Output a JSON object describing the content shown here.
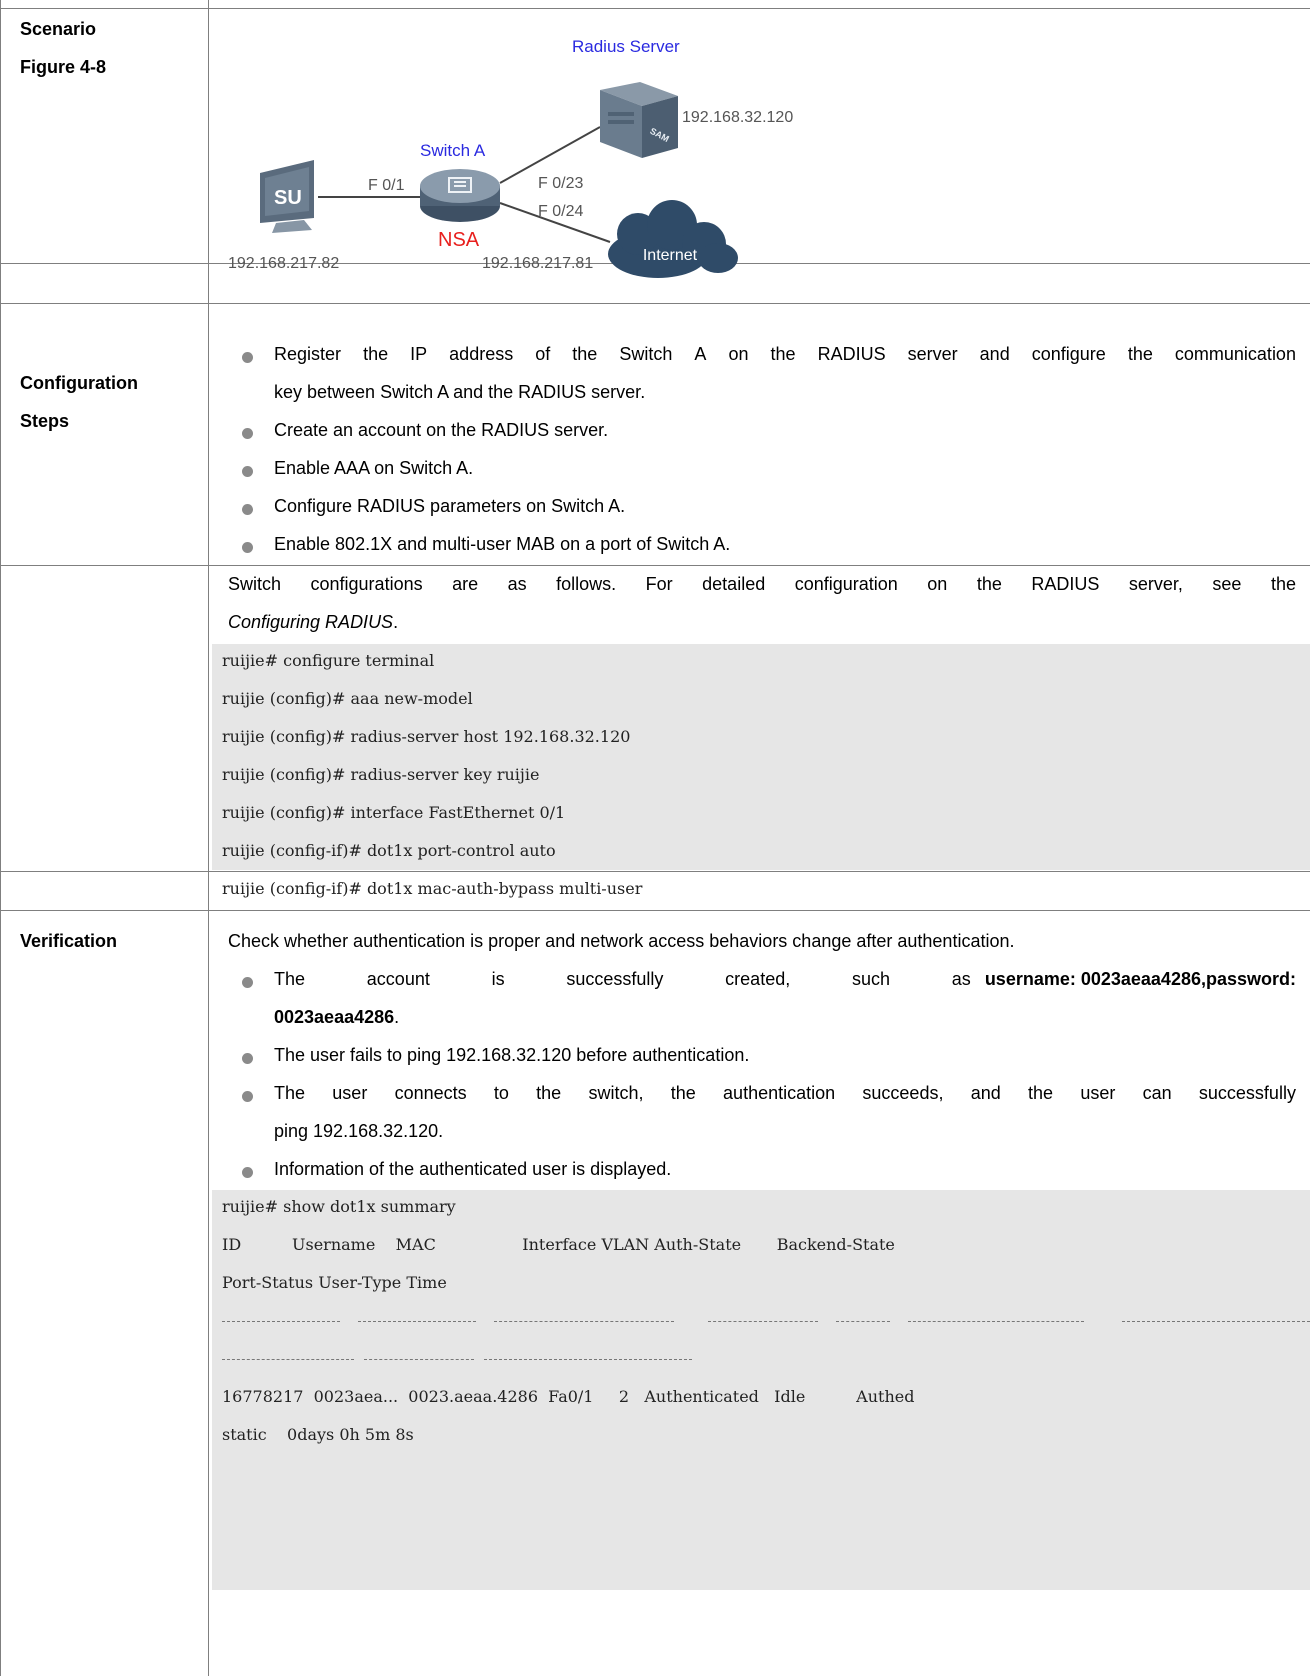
{
  "row_labels": {
    "scenario": "Scenario",
    "figure": "Figure 4-8",
    "config_1": "Configuration",
    "config_2": "Steps",
    "verification": "Verification"
  },
  "diagram": {
    "server_title": "Radius Server",
    "server_ip": "192.168.32.120",
    "switch_title": "Switch A",
    "switch_tag": "NSA",
    "client_port": "F 0/1",
    "server_port": "F 0/23",
    "internet_port": "F 0/24",
    "client_ip": "192.168.217.82",
    "switch_ip": "192.168.217.81",
    "internet_label": "Internet",
    "client_badge": "SU",
    "server_badge": "SAM",
    "colors": {
      "title_blue": "#2a2ae0",
      "nsa_red": "#e8201e",
      "device": "#5f7184",
      "cloud": "#2f4b68"
    }
  },
  "config": {
    "step1_a_words": [
      "Register",
      "the",
      "IP",
      "address",
      "of",
      "the",
      "Switch",
      "A",
      "on",
      "the",
      "RADIUS",
      "server",
      "and",
      "configure",
      "the",
      "communication"
    ],
    "step1_b": "key between Switch A and the RADIUS server.",
    "step2": "Create an account on the RADIUS server.",
    "step3": "Enable AAA on Switch A.",
    "step4": "Configure RADIUS parameters on Switch A.",
    "step5": "Enable 802.1X and multi-user MAB on a port of Switch A.",
    "note_a_words": [
      "Switch",
      "configurations",
      "are",
      "as",
      "follows.",
      "For",
      "detailed",
      "configuration",
      "on",
      "the",
      "RADIUS",
      "server,",
      "see",
      "the"
    ],
    "note_b_italic": "Configuring RADIUS",
    "note_b_end": "."
  },
  "config_code": [
    "ruijie# configure terminal",
    "ruijie (config)# aaa new-model",
    "ruijie (config)# radius-server host 192.168.32.120",
    "ruijie (config)# radius-server key ruijie",
    "ruijie (config)# interface FastEthernet 0/1",
    "ruijie (config-if)# dot1x port-control auto",
    "ruijie (config-if)# dot1x mac-auth-bypass multi-user"
  ],
  "verification": {
    "intro": "Check whether authentication is proper and network access behaviors change after authentication.",
    "b1_a_words": [
      "The",
      "account",
      "is",
      "successfully",
      "created,",
      "such",
      "as"
    ],
    "b1_a_bold": "username: 0023aeaa4286,password:",
    "b1_b_bold": "0023aeaa4286",
    "b1_b_end": ".",
    "b2": "The user fails to ping 192.168.32.120 before authentication.",
    "b3_a_words": [
      "The",
      "user",
      "connects",
      "to",
      "the",
      "switch,",
      "the",
      "authentication",
      "succeeds,",
      "and",
      "the",
      "user",
      "can",
      "successfully"
    ],
    "b3_b": "ping 192.168.32.120.",
    "b4": "Information of the authenticated user is displayed."
  },
  "summary": {
    "command": "ruijie# show dot1x summary",
    "header_1": "ID          Username    MAC                 Interface VLAN Auth-State       Backend-State",
    "header_2": "Port-Status User-Type Time",
    "row_1": "16778217  0023aea...  0023.aeaa.4286  Fa0/1     2   Authenticated   Idle          Authed",
    "row_2": "static    0days 0h 5m 8s"
  }
}
